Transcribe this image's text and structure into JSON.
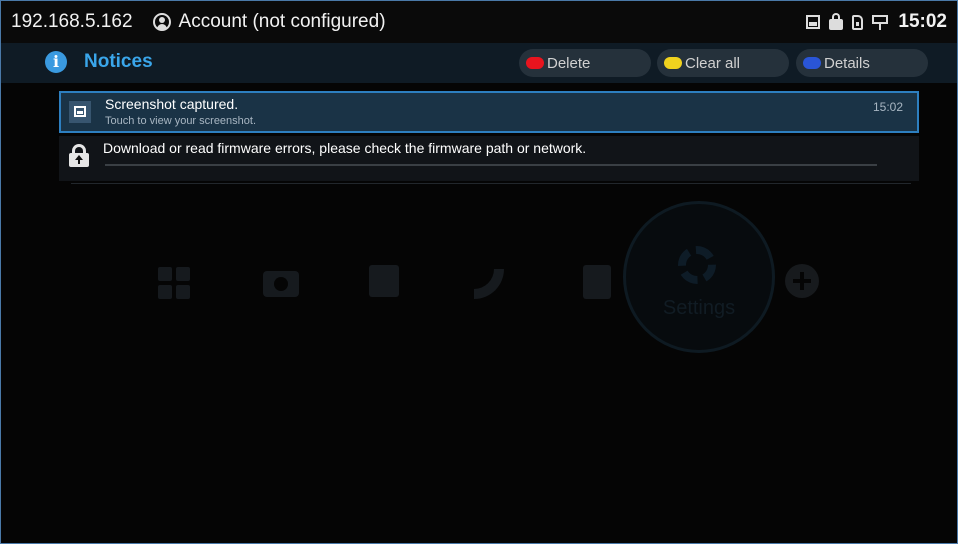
{
  "status_bar": {
    "ip": "192.168.5.162",
    "account_label": "Account (not configured)",
    "time": "15:02",
    "icons": [
      "picture-icon",
      "lock-icon",
      "sim-card-icon",
      "network-icon"
    ]
  },
  "notices": {
    "title": "Notices",
    "buttons": {
      "delete": {
        "label": "Delete",
        "color": "#e8141e"
      },
      "clear_all": {
        "label": "Clear all",
        "color": "#f0d21e"
      },
      "details": {
        "label": "Details",
        "color": "#2a55d6"
      }
    }
  },
  "notifications": [
    {
      "icon": "picture-icon",
      "title": "Screenshot captured.",
      "subtitle": "Touch to view your screenshot.",
      "time": "15:02"
    },
    {
      "icon": "lock-upload-icon",
      "title": "Download or read firmware errors, please check the firmware path or network."
    }
  ],
  "background_home": {
    "icons": [
      "apps-icon",
      "camera-icon",
      "calendar-icon",
      "phone-icon",
      "contacts-icon",
      "settings-icon",
      "add-icon"
    ],
    "settings_label": "Settings"
  },
  "colors": {
    "accent": "#3aa6ea",
    "selected_border": "#2d7fc0",
    "selected_bg": "#1a3346"
  }
}
